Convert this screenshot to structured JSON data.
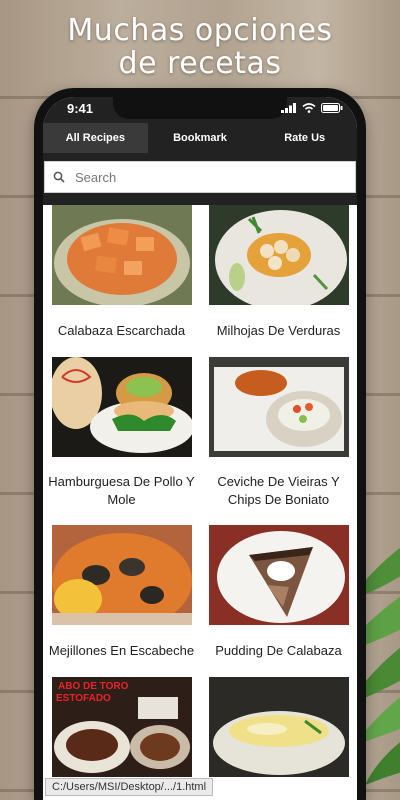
{
  "headline": {
    "line1": "Muchas opciones",
    "line2": "de recetas"
  },
  "status": {
    "time": "9:41"
  },
  "tabs": [
    {
      "label": "All Recipes",
      "active": true
    },
    {
      "label": "Bookmark",
      "active": false
    },
    {
      "label": "Rate Us",
      "active": false
    }
  ],
  "search": {
    "placeholder": "Search"
  },
  "recipes": [
    {
      "name": "Calabaza Escarchada"
    },
    {
      "name": "Milhojas De Verduras"
    },
    {
      "name": "Hamburguesa De Pollo Y Mole"
    },
    {
      "name": "Ceviche De Vieiras Y Chips De Boniato"
    },
    {
      "name": "Mejillones En Escabeche"
    },
    {
      "name": "Pudding De Calabaza"
    },
    {
      "name": ""
    },
    {
      "name": ""
    }
  ],
  "thumb_text": {
    "line1": "ABO DE TORO",
    "line2": "ESTOFADO"
  },
  "url_status": "C:/Users/MSI/Desktop/.../1.html",
  "colors": {
    "bar": "#222222",
    "active_tab": "#3a3a3a",
    "card_bg": "#ffffff"
  }
}
